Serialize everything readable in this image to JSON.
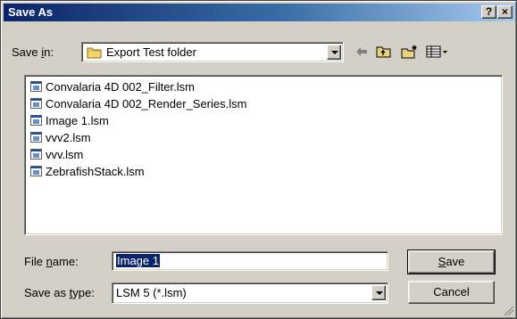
{
  "dialog": {
    "title": "Save As",
    "help_label": "?",
    "close_label": "×"
  },
  "save_in": {
    "label_pre": "Save ",
    "label_key": "i",
    "label_post": "n:",
    "value": "Export Test folder"
  },
  "files": [
    "Convalaria 4D 002_Filter.lsm",
    "Convalaria 4D 002_Render_Series.lsm",
    "Image 1.lsm",
    "vvv2.lsm",
    "vvv.lsm",
    "ZebrafishStack.lsm"
  ],
  "filename": {
    "label_pre": "File ",
    "label_key": "n",
    "label_post": "ame:",
    "value": "Image 1"
  },
  "filetype": {
    "label_pre": "Save as ",
    "label_key": "t",
    "label_post": "ype:",
    "value": "LSM 5 (*.lsm)"
  },
  "buttons": {
    "save_key": "S",
    "save_rest": "ave",
    "cancel": "Cancel"
  }
}
